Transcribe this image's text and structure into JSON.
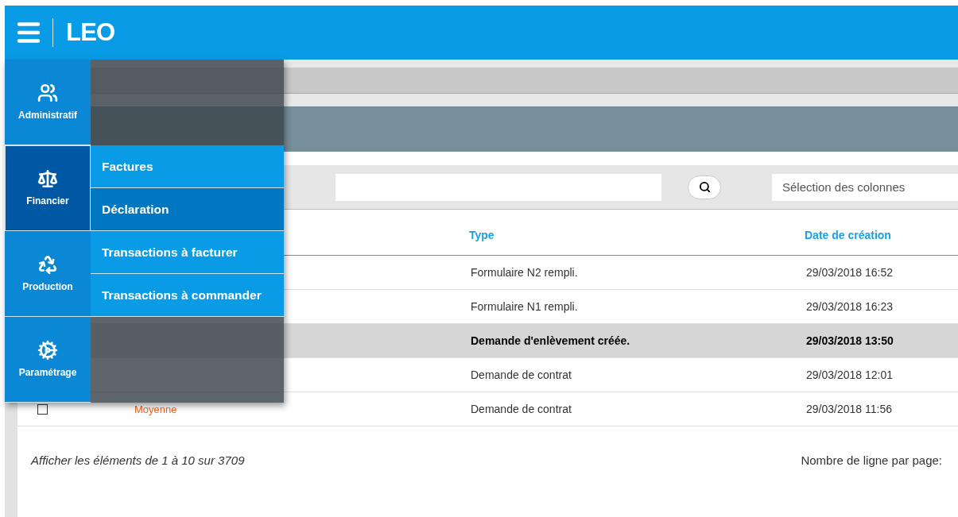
{
  "header": {
    "title": "LEO"
  },
  "toolbar": {
    "column_select": {
      "placeholder": "Sélection des colonnes"
    }
  },
  "table": {
    "columns": [
      "Type",
      "Date de création"
    ],
    "rows": [
      {
        "type": "Formulaire N2 rempli.",
        "date": "29/03/2018 16:52",
        "selected": false
      },
      {
        "type": "Formulaire N1 rempli.",
        "date": "29/03/2018 16:23",
        "selected": false
      },
      {
        "type": "Demande d'enlèvement créée.",
        "date": "29/03/2018 13:50",
        "selected": true
      },
      {
        "type": "Demande de contrat",
        "date": "29/03/2018 12:01",
        "selected": false
      },
      {
        "checked": false,
        "priority": "Moyenne",
        "color": "#f0641e",
        "type": "Demande de contrat",
        "date": "29/03/2018 11:56",
        "selected": false
      }
    ]
  },
  "footer": {
    "summary": "Afficher les éléments de 1 à 10 sur 3709",
    "page_size_label": "Nombre de ligne par page:"
  },
  "nav": {
    "items": [
      {
        "kind": "users",
        "label": "Administratif",
        "selected": false
      },
      {
        "kind": "scale",
        "label": "Financier",
        "selected": true
      },
      {
        "kind": "recycle",
        "label": "Production",
        "selected": false
      },
      {
        "kind": "cogs",
        "label": "Paramétrage",
        "selected": false
      }
    ],
    "submenu": [
      {
        "label": "Factures",
        "selected": false
      },
      {
        "label": "Déclaration",
        "selected": true
      },
      {
        "label": "Transactions à facturer",
        "selected": false
      },
      {
        "label": "Transactions à commander",
        "selected": false
      }
    ]
  }
}
